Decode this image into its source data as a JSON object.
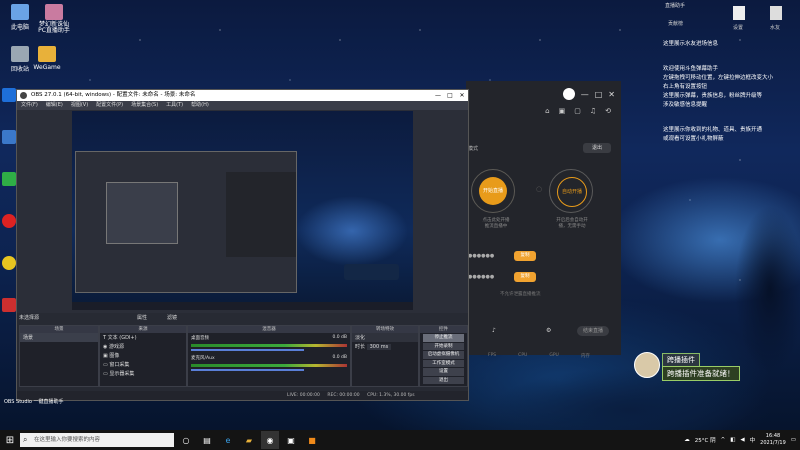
{
  "desktop": {
    "icons": [
      {
        "label": "此电脑",
        "color": "#6aa3e6"
      },
      {
        "label": "梦幻新诛仙\nPC直播助手",
        "color": "#c97ba0"
      },
      {
        "label": "回收站",
        "color": "#9aa7b3"
      },
      {
        "label": "WeGame",
        "color": "#e8b13a"
      }
    ],
    "obs_shortcut_label": "OBS Studio 一键直播助手"
  },
  "obs": {
    "title": "OBS 27.0.1 (64-bit, windows) - 配置文件: 未命名 - 场景: 未命名",
    "menu": [
      "文件(F)",
      "编辑(E)",
      "视图(V)",
      "配置文件(P)",
      "场景集合(S)",
      "工具(T)",
      "帮助(H)"
    ],
    "no_source_label": "未选择源",
    "properties_label": "属性",
    "filters_label": "滤镜",
    "scenes_header": "场景",
    "scene_item": "场景",
    "sources_header": "来源",
    "sources": [
      {
        "icon": "T",
        "name": "文本 (GDI+)"
      },
      {
        "icon": "◉",
        "name": "游戏源"
      },
      {
        "icon": "▣",
        "name": "图像"
      },
      {
        "icon": "▭",
        "name": "窗口采集"
      },
      {
        "icon": "▭",
        "name": "显示器采集"
      }
    ],
    "mixer_header": "混音器",
    "mixer": [
      {
        "name": "桌面音频",
        "level": "0.0 dB"
      },
      {
        "name": "麦克风/Aux",
        "level": "0.0 dB"
      }
    ],
    "transitions_header": "转场特效",
    "transition_type": "淡化",
    "duration_label": "时长",
    "duration_value": "300 ms",
    "controls_header": "控件",
    "controls": [
      "停止推流",
      "开始录制",
      "启动虚拟摄像机",
      "工作室模式",
      "设置",
      "退出"
    ],
    "status": {
      "live": "LIVE: 00:00:00",
      "rec": "REC: 00:00:00",
      "cpu": "CPU: 1.3%, 30.00 fps"
    }
  },
  "dark_app": {
    "exit_label": "退出",
    "mode_label": "模式",
    "start_stream": "开始直播",
    "auto_stream": "自动开播",
    "caption_left": "点击此处开播\n推流直播中",
    "caption_right": "开启后会自动开\n播，无需手动",
    "key_mask": "●●●●●●",
    "copy_label": "复制",
    "hint": "不允许泄露直播推流",
    "toolbar_items": [
      "FPS",
      "CPU",
      "GPU",
      "内存"
    ],
    "bottom_button": "结束直播"
  },
  "notes": {
    "helper": "直播助手",
    "items": [
      "这里展示水友进场信息",
      "欢迎使用斗鱼弹幕助手\n左键拖拽可移动位置，左键拉伸边框改变大小\n右上角有设置按钮\n这里展示弹幕，贵族信息，粉丝牌升级等\n涉及敏感信息提醒",
      "这里展示你收到的礼物、道具、贵族开通\n或观看可设置小礼物屏蔽"
    ],
    "top_buttons": [
      "贡献榜",
      "设置",
      "水友"
    ]
  },
  "kuobo": {
    "name": "跨播插件",
    "message": "跨播插件准备就绪！"
  },
  "taskbar": {
    "search_placeholder": "在这里输入你要搜索的内容",
    "weather": "25°C 阴",
    "time": "16:48",
    "date": "2021/7/19"
  }
}
